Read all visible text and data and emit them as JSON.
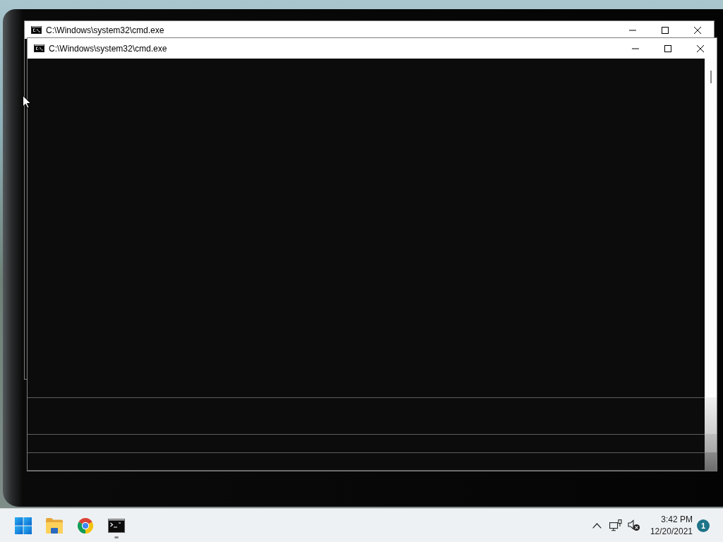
{
  "windows": [
    {
      "title": "C:\\Windows\\system32\\cmd.exe"
    },
    {
      "title": "C:\\Windows\\system32\\cmd.exe"
    }
  ],
  "taskbar": {
    "apps": [
      {
        "kind": "start",
        "running": false
      },
      {
        "kind": "explorer",
        "running": false
      },
      {
        "kind": "browser",
        "running": false
      },
      {
        "kind": "terminal",
        "running": true
      }
    ],
    "clock": {
      "time": "3:42 PM",
      "date": "12/20/2021"
    },
    "notification_count": "1"
  }
}
